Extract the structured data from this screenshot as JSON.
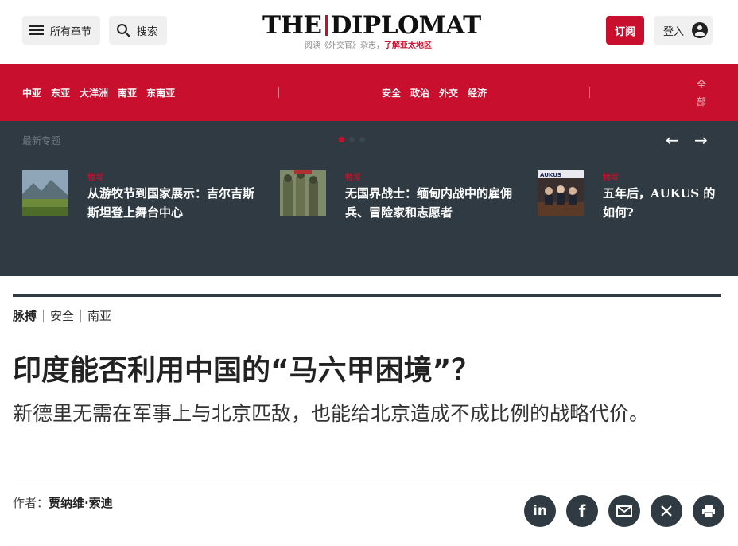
{
  "header": {
    "chapters_label": "所有章节",
    "search_label": "搜索",
    "logo_left": "THE",
    "logo_right": "DIPLOMAT",
    "tagline_prefix": "阅读《外交官》杂志，",
    "tagline_emphasis": "了解亚太地区",
    "subscribe_label": "订阅",
    "login_label": "登入"
  },
  "nav": {
    "regions": [
      "中亚",
      "东亚",
      "大洋洲",
      "南亚",
      "东南亚"
    ],
    "topics": [
      "安全",
      "政治",
      "外交",
      "经济"
    ],
    "all_label": "全部"
  },
  "carousel": {
    "label": "最新专题",
    "dot_count": 3,
    "active_dot": 0,
    "prev": "←",
    "next": "→",
    "cards": [
      {
        "tag": "特写",
        "title": "从游牧节到国家展示：吉尔吉斯斯坦登上舞台中心"
      },
      {
        "tag": "特写",
        "title": "无国界战士：缅甸内战中的雇佣兵、冒险家和志愿者"
      },
      {
        "tag": "特写",
        "title_line1": "五年后，AUKUS 的",
        "title_line2": "如何?"
      }
    ]
  },
  "article": {
    "breadcrumb": [
      "脉搏",
      "安全",
      "南亚"
    ],
    "headline": "印度能否利用中国的“马六甲困境”？",
    "subheadline": "新德里无需在军事上与北京匹敌，也能给北京造成不成比例的战略代价。",
    "byline_prefix": "作者：",
    "author": "贾纳维·索迪",
    "share_icons": [
      "linkedin-icon",
      "facebook-icon",
      "email-icon",
      "x-icon",
      "print-icon"
    ]
  },
  "colors": {
    "brand_red": "#c8102e",
    "dark_slate": "#2f3a42"
  }
}
